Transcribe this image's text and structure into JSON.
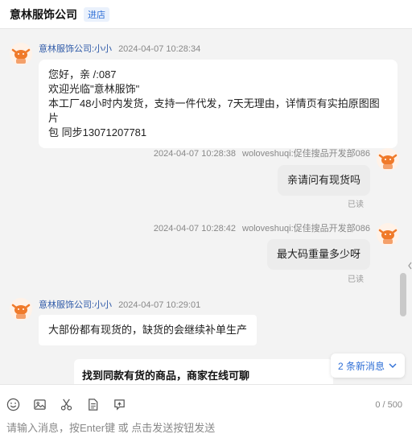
{
  "header": {
    "shop_name": "意林服饰公司",
    "enter_label": "进店"
  },
  "messages": [
    {
      "sender": "意林服饰公司:小小",
      "time": "2024-04-07 10:28:34",
      "lines": [
        "您好，亲  /:087",
        "欢迎光临\"意林服饰\"",
        "本工厂48小时内发货，支持一件代发，7天无理由，详情页有实拍原图图片",
        "包 同步13071207781"
      ]
    },
    {
      "time": "2024-04-07 10:28:38",
      "sender": "woloveshuqi:促佳搜品开发部086",
      "text": "亲请问有现货吗",
      "status": "已读"
    },
    {
      "time": "2024-04-07 10:28:42",
      "sender": "woloveshuqi:促佳搜品开发部086",
      "text": "最大码重量多少呀",
      "status": "已读"
    },
    {
      "sender": "意林服饰公司:小小",
      "time": "2024-04-07 10:29:01",
      "text": "大部份都有现货的，缺货的会继续补单生产"
    }
  ],
  "card": {
    "text": "找到同款有货的商品，商家在线可聊"
  },
  "new_messages": {
    "label": "2 条新消息"
  },
  "composer": {
    "counter": "0 / 500",
    "placeholder": "请输入消息，按Enter键 或 点击发送按钮发送",
    "value": ""
  },
  "icons": [
    "emoji-icon",
    "image-icon",
    "scissors-icon",
    "document-icon",
    "refresh-icon",
    "chevron-down-icon",
    "avatar-icon"
  ],
  "colors": {
    "accent": "#2f6fd6",
    "shop_name_link": "#2f5aa8",
    "right_bubble": "#ececec",
    "avatar_orange": "#f07a2a"
  }
}
